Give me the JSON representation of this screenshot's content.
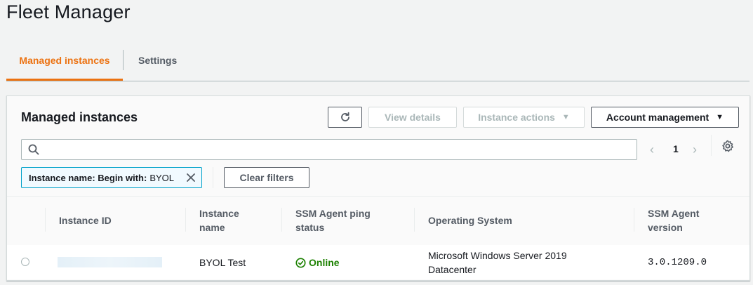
{
  "page": {
    "title": "Fleet Manager"
  },
  "tabs": [
    {
      "label": "Managed instances",
      "active": true
    },
    {
      "label": "Settings",
      "active": false
    }
  ],
  "panel": {
    "title": "Managed instances",
    "buttons": {
      "view_details": "View details",
      "instance_actions": "Instance actions",
      "account_management": "Account management"
    },
    "search": {
      "value": "",
      "placeholder": ""
    },
    "pagination": {
      "current_page": "1"
    },
    "filter_token": {
      "label": "Instance name: Begin with:",
      "value": "BYOL"
    },
    "clear_filters": "Clear filters"
  },
  "table": {
    "columns": [
      {
        "line1": "Instance ID",
        "line2": ""
      },
      {
        "line1": "Instance",
        "line2": "name"
      },
      {
        "line1": "SSM Agent ping",
        "line2": "status"
      },
      {
        "line1": "Operating System",
        "line2": ""
      },
      {
        "line1": "SSM Agent",
        "line2": "version"
      }
    ],
    "rows": [
      {
        "instance_id": "",
        "instance_name": "BYOL Test",
        "ping_status": "Online",
        "os_line1": "Microsoft Windows Server 2019",
        "os_line2": "Datacenter",
        "agent_version": "3.0.1209.0"
      }
    ]
  },
  "colors": {
    "accent": "#ec7211",
    "online": "#1d8102",
    "token_border": "#00a1c9"
  },
  "icons": [
    "refresh-icon",
    "caret-down-icon",
    "search-icon",
    "chevron-left-icon",
    "chevron-right-icon",
    "gear-icon",
    "close-icon",
    "check-circle-icon"
  ]
}
